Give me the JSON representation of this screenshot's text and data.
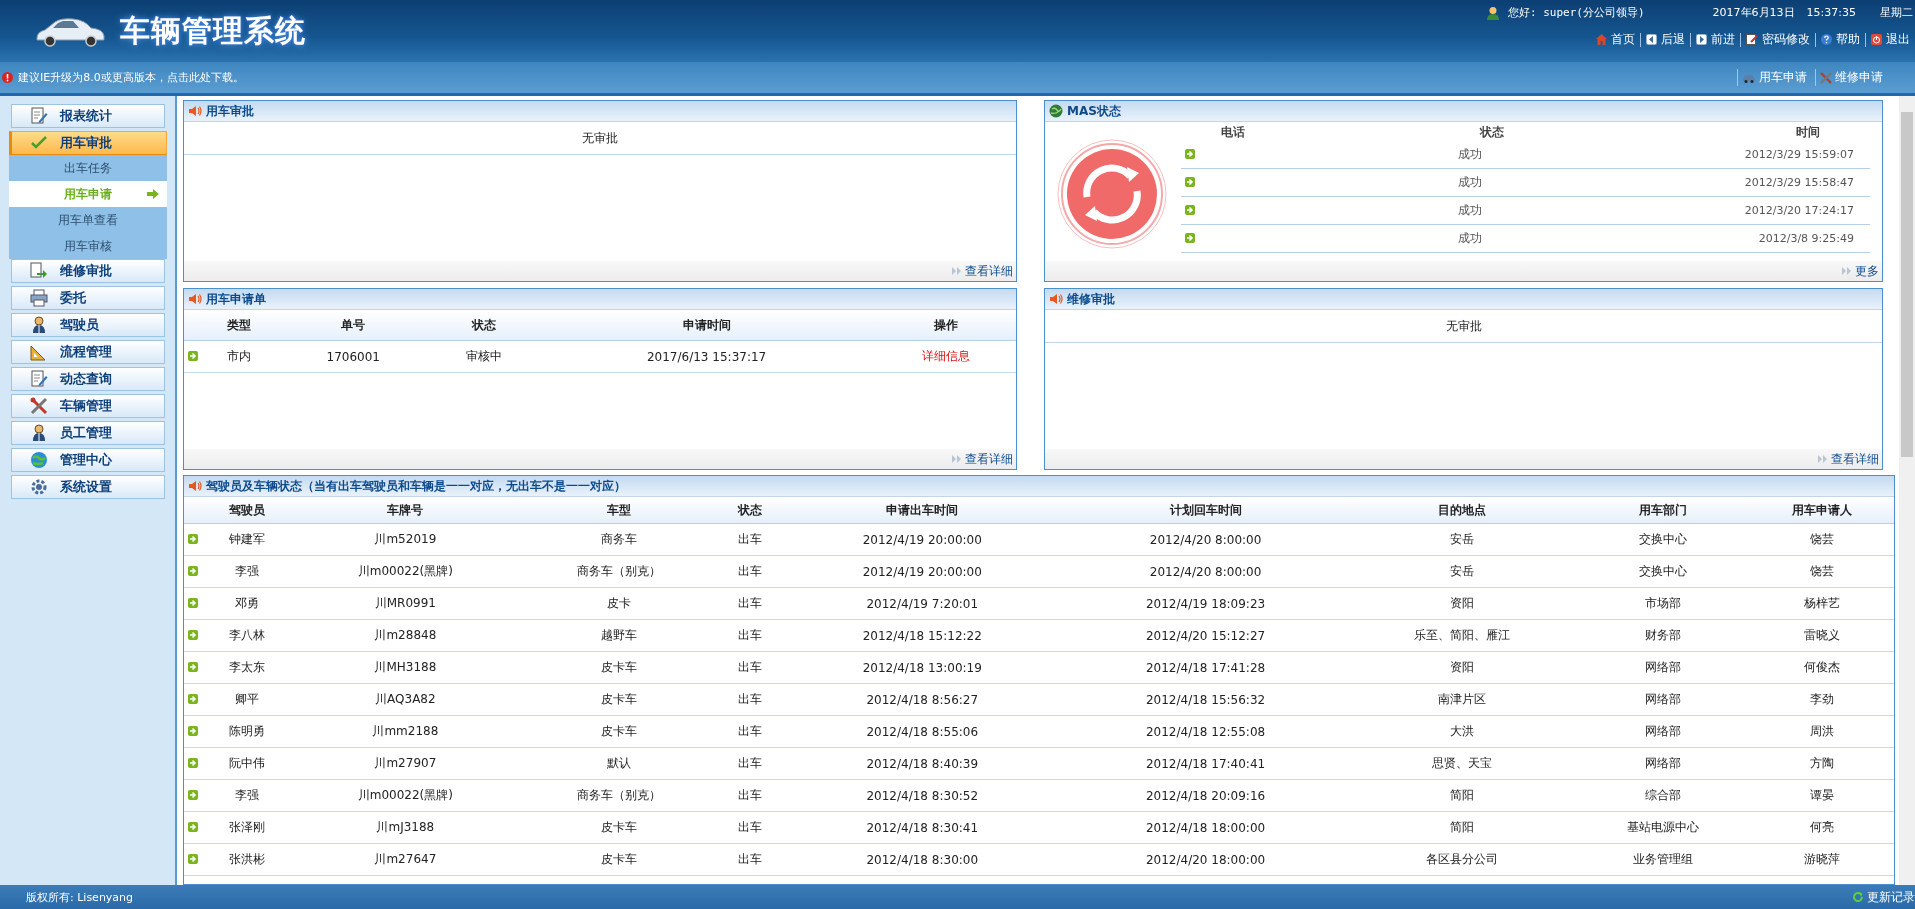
{
  "header": {
    "title": "车辆管理系统",
    "greeting": "您好: super(分公司领导)",
    "date": "2017年6月13日",
    "time": "15:37:35",
    "weekday": "星期二",
    "nav": [
      {
        "label": "首页"
      },
      {
        "label": "后退"
      },
      {
        "label": "前进"
      },
      {
        "label": "密码修改"
      },
      {
        "label": "帮助"
      },
      {
        "label": "退出"
      }
    ]
  },
  "notice_bar": {
    "message": "建议IE升级为8.0或更高版本，点击此处下载。",
    "quick_links": [
      {
        "label": "用车申请"
      },
      {
        "label": "维修申请"
      }
    ]
  },
  "sidebar": {
    "items": [
      {
        "label": "报表统计",
        "selected": false
      },
      {
        "label": "用车审批",
        "selected": true,
        "expanded": true,
        "children": [
          {
            "label": "出车任务",
            "selected": false
          },
          {
            "label": "用车申请",
            "selected": true
          },
          {
            "label": "用车单查看",
            "selected": false
          },
          {
            "label": "用车审核",
            "selected": false
          }
        ]
      },
      {
        "label": "维修审批",
        "selected": false
      },
      {
        "label": "委托",
        "selected": false
      },
      {
        "label": "驾驶员",
        "selected": false
      },
      {
        "label": "流程管理",
        "selected": false
      },
      {
        "label": "动态查询",
        "selected": false
      },
      {
        "label": "车辆管理",
        "selected": false
      },
      {
        "label": "员工管理",
        "selected": false
      },
      {
        "label": "管理中心",
        "selected": false
      },
      {
        "label": "系统设置",
        "selected": false
      }
    ]
  },
  "approval_panel": {
    "title": "用车审批",
    "message": "无审批",
    "more": "查看详细"
  },
  "mas_panel": {
    "title": "MAS状态",
    "columns": [
      "电话",
      "状态",
      "时间"
    ],
    "rows": [
      {
        "status": "成功",
        "time": "2012/3/29 15:59:07"
      },
      {
        "status": "成功",
        "time": "2012/3/29 15:58:47"
      },
      {
        "status": "成功",
        "time": "2012/3/20 17:24:17"
      },
      {
        "status": "成功",
        "time": "2012/3/8 9:25:49"
      }
    ],
    "more": "更多"
  },
  "request_panel": {
    "title": "用车申请单",
    "columns": [
      "类型",
      "单号",
      "状态",
      "申请时间",
      "操作"
    ],
    "rows": [
      {
        "cells": [
          "市内",
          "1706001",
          "审核中",
          "2017/6/13 15:37:17"
        ],
        "action": "详细信息"
      }
    ],
    "more": "查看详细"
  },
  "repair_panel": {
    "title": "维修审批",
    "message": "无审批",
    "more": "查看详细"
  },
  "driver_panel": {
    "title": "驾驶员及车辆状态（当有出车驾驶员和车辆是一一对应，无出车不是一一对应）",
    "columns": [
      "驾驶员",
      "车牌号",
      "车型",
      "状态",
      "申请出车时间",
      "计划回车时间",
      "目的地点",
      "用车部门",
      "用车申请人"
    ],
    "rows": [
      [
        "钟建军",
        "川m52019",
        "商务车",
        "出车",
        "2012/4/19 20:00:00",
        "2012/4/20 8:00:00",
        "安岳",
        "交换中心",
        "饶芸"
      ],
      [
        "李强",
        "川m00022(黑牌)",
        "商务车（别克）",
        "出车",
        "2012/4/19 20:00:00",
        "2012/4/20 8:00:00",
        "安岳",
        "交换中心",
        "饶芸"
      ],
      [
        "邓勇",
        "川MR0991",
        "皮卡",
        "出车",
        "2012/4/19 7:20:01",
        "2012/4/19 18:09:23",
        "资阳",
        "市场部",
        "杨梓艺"
      ],
      [
        "李八林",
        "川m28848",
        "越野车",
        "出车",
        "2012/4/18 15:12:22",
        "2012/4/20 15:12:27",
        "乐至、简阳、雁江",
        "财务部",
        "雷晓义"
      ],
      [
        "李太东",
        "川MH3188",
        "皮卡车",
        "出车",
        "2012/4/18 13:00:19",
        "2012/4/18 17:41:28",
        "资阳",
        "网络部",
        "何俊杰"
      ],
      [
        "卿平",
        "川AQ3A82",
        "皮卡车",
        "出车",
        "2012/4/18 8:56:27",
        "2012/4/18 15:56:32",
        "南津片区",
        "网络部",
        "李劲"
      ],
      [
        "陈明勇",
        "川mm2188",
        "皮卡车",
        "出车",
        "2012/4/18 8:55:06",
        "2012/4/18 12:55:08",
        "大洪",
        "网络部",
        "周洪"
      ],
      [
        "阮中伟",
        "川m27907",
        "默认",
        "出车",
        "2012/4/18 8:40:39",
        "2012/4/18 17:40:41",
        "思贤、天宝",
        "网络部",
        "方陶"
      ],
      [
        "李强",
        "川m00022(黑牌)",
        "商务车（别克）",
        "出车",
        "2012/4/18 8:30:52",
        "2012/4/18 20:09:16",
        "简阳",
        "综合部",
        "谭晏"
      ],
      [
        "张泽刚",
        "川mJ3188",
        "皮卡车",
        "出车",
        "2012/4/18 8:30:41",
        "2012/4/18 18:00:00",
        "简阳",
        "基站电源中心",
        "何亮"
      ],
      [
        "张洪彬",
        "川m27647",
        "皮卡车",
        "出车",
        "2012/4/18 8:30:00",
        "2012/4/20 18:00:00",
        "各区县分公司",
        "业务管理组",
        "游晓萍"
      ]
    ]
  },
  "footer": {
    "copyright": "版权所有: Lisenyang",
    "update_link": "更新记录"
  }
}
